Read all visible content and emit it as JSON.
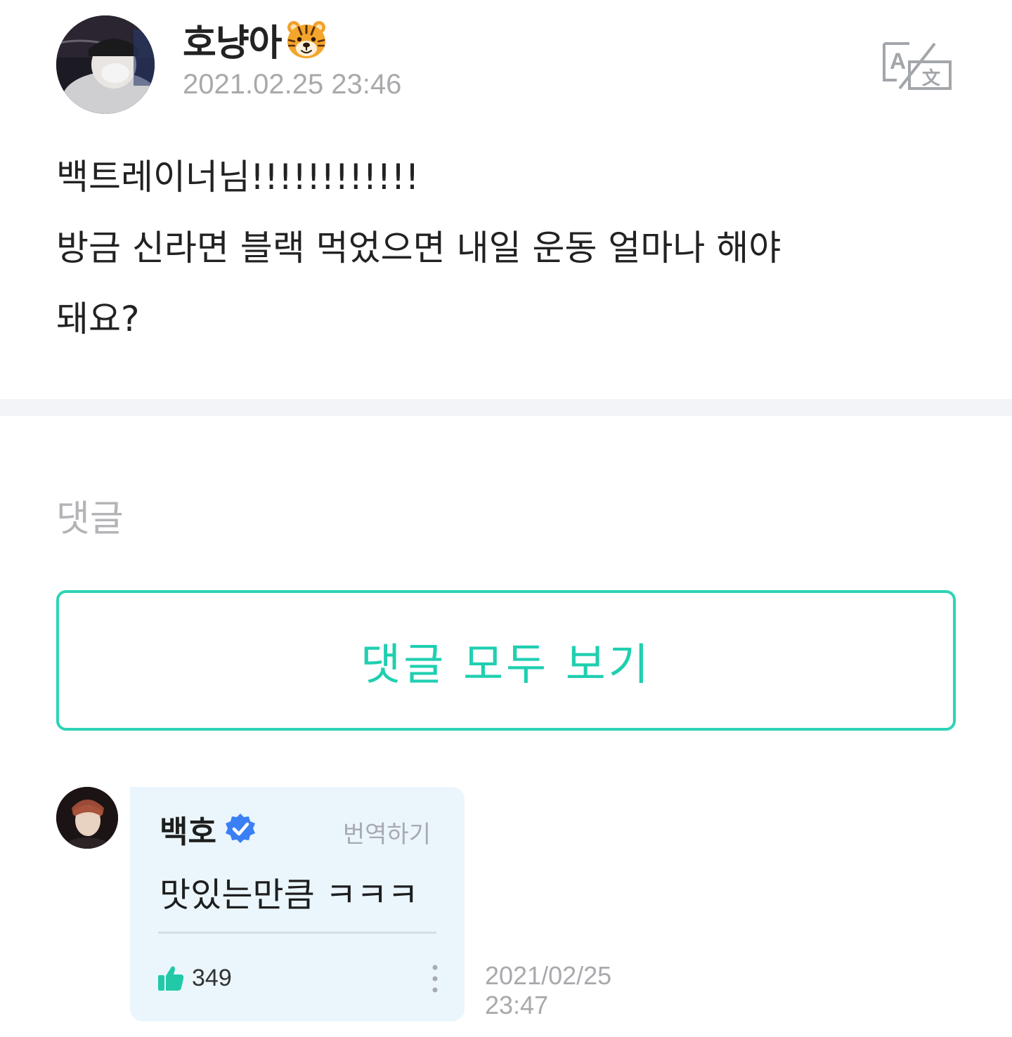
{
  "post": {
    "author_name": "호냥아",
    "author_emoji": "tiger-face-emoji",
    "timestamp": "2021.02.25 23:46",
    "translate_icon": "translate-icon",
    "body_lines": [
      "백트레이너님!!!!!!!!!!!!",
      "방금 신라면 블랙 먹었으면 내일 운동 얼마나 해야",
      "돼요?"
    ]
  },
  "comments": {
    "heading": "댓글",
    "view_all_label": "댓글 모두 보기",
    "items": [
      {
        "author": "백호",
        "verified_icon": "verified-badge-icon",
        "translate_label": "번역하기",
        "text": "맛있는만큼 ㅋㅋㅋ",
        "likes": "349",
        "like_icon": "thumbs-up-icon",
        "more_icon": "more-vertical-icon",
        "date": "2021/02/25",
        "time": "23:47"
      }
    ]
  },
  "colors": {
    "accent": "#2ed3b5",
    "accent_text": "#1fcfb0",
    "muted_text": "#a9a9ad",
    "bubble_bg": "#eaf6fc",
    "divider_bg": "#f3f4f8",
    "verified_blue": "#3b7ff5"
  }
}
